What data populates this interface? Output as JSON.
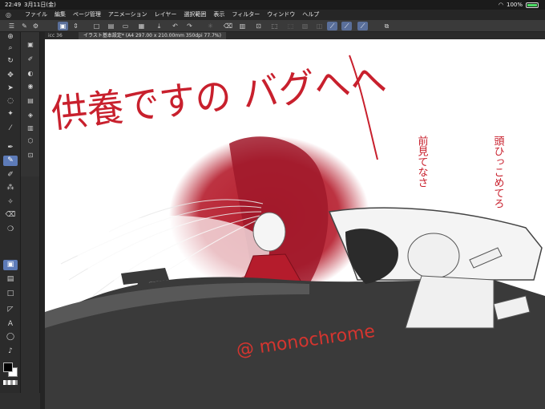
{
  "status_bar": {
    "time": "22:49",
    "date": "3月11日(金)",
    "battery": "100%"
  },
  "menu": {
    "items": [
      "ファイル",
      "編集",
      "ページ管理",
      "アニメーション",
      "レイヤー",
      "選択範囲",
      "表示",
      "フィルター",
      "ウィンドウ",
      "ヘルプ"
    ]
  },
  "tabs": {
    "small": "icc 36",
    "main": "イラスト基本設定* (A4 297.00 x 210.00mm 350dpi 77.7%)"
  },
  "canvas": {
    "title_text": "供養ですの バグへへ",
    "note_left": "前見てなさ",
    "note_right": "頭ひっこめてろ",
    "watermark": "@ monochrome",
    "colors": {
      "red_paint": "#b51c2c",
      "car_gray": "#3a3a3a",
      "sketch_line": "#555555"
    }
  },
  "colors": {
    "accent": "#5d7bb8",
    "foreground": "#000000",
    "background": "#ffffff"
  }
}
